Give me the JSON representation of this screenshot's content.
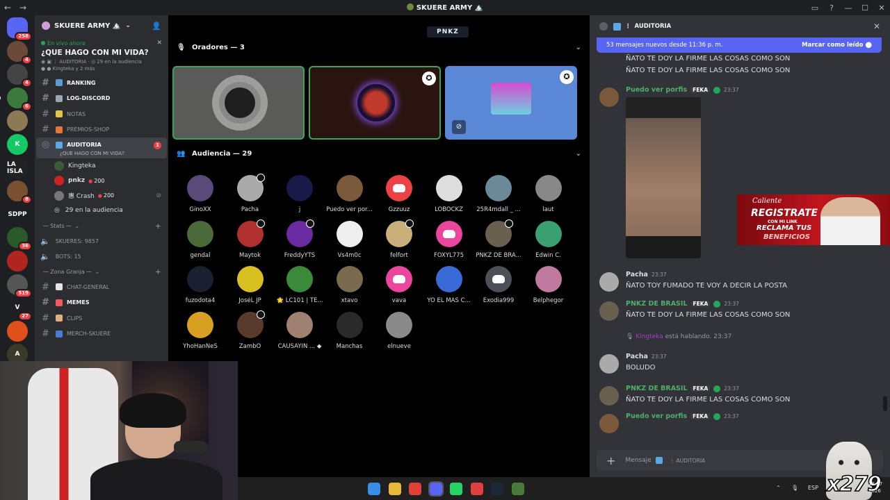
{
  "window": {
    "title": "SKUERE ARMY 🏔️",
    "controls": [
      "▭",
      "?",
      "—",
      "☐",
      "✕"
    ]
  },
  "servers": [
    {
      "label": "",
      "badge": "258",
      "color": "#5865f2",
      "home": true
    },
    {
      "label": "",
      "badge": "4",
      "color": "#6b4a3a"
    },
    {
      "label": "",
      "badge": "4",
      "color": "#444"
    },
    {
      "label": "",
      "badge": "6",
      "color": "#3a7a3a"
    },
    {
      "label": "",
      "badge": "",
      "color": "#8c7a55"
    },
    {
      "label": "K",
      "badge": "",
      "color": "#17c964"
    },
    {
      "label": "LA ISLA",
      "badge": "",
      "color": "#222"
    },
    {
      "label": "",
      "badge": "8",
      "color": "#7a5030"
    },
    {
      "label": "SDPP",
      "badge": "",
      "color": "#1e1f22"
    },
    {
      "label": "",
      "badge": "36",
      "color": "#2a5a2a"
    },
    {
      "label": "",
      "badge": "",
      "color": "#b0261e"
    },
    {
      "label": "",
      "badge": "519",
      "color": "#555"
    },
    {
      "label": "V",
      "badge": "27",
      "color": "#1e1f22"
    },
    {
      "label": "",
      "badge": "",
      "color": "#e0501c"
    },
    {
      "label": "A",
      "badge": "",
      "color": "#3a3a2a"
    }
  ],
  "sidebar": {
    "server_name": "SKUERE ARMY 🏔️",
    "event": {
      "live": "En vivo ahora",
      "title": "¿QUE HAGO CON MI VIDA?",
      "channel": "AUDITORIA",
      "audience": "29 en la audiencia",
      "users": "Kingteka y 2 más"
    },
    "channels": [
      {
        "name": "RANKING",
        "bold": true,
        "emoji": "#5a9bd8"
      },
      {
        "name": "LOG-DISCORD",
        "bold": true,
        "emoji": "#9aa6b2"
      },
      {
        "name": "NOTAS",
        "bold": false,
        "emoji": "#e6c34a"
      },
      {
        "name": "PREMIOS-SHOP",
        "bold": false,
        "emoji": "#e07a3a"
      }
    ],
    "active_channel": {
      "name": "AUDITORIA",
      "sub": "¿QUE HAGO CON MI VIDA?",
      "badge": "1"
    },
    "voice_users": [
      {
        "name": "Kingteka",
        "coins": "",
        "color": "#3a5a3a",
        "muted": false
      },
      {
        "name": "pnkz",
        "coins": "200",
        "color": "#c22",
        "muted": false
      },
      {
        "name": "惠 Crash",
        "coins": "200",
        "color": "#777",
        "muted": true
      }
    ],
    "audience_line": "29 en la audiencia",
    "stats_category": "Stats",
    "stats": [
      {
        "label": "SKUERES: 9857"
      },
      {
        "label": "BOTS: 15"
      }
    ],
    "granja_category": "Zona Granja",
    "granja_channels": [
      {
        "name": "CHAT-GENERAL",
        "bold": false,
        "emoji": "#e6e6e6"
      },
      {
        "name": "MEMES",
        "bold": true,
        "emoji": "#f05a5a"
      },
      {
        "name": "CLIPS",
        "bold": false,
        "emoji": "#e0b080"
      },
      {
        "name": "MERCH-SKUERE",
        "bold": false,
        "emoji": "#4a7ad8"
      }
    ]
  },
  "stage": {
    "logo": "PNKZ",
    "speakers_header": "Oradores — 3",
    "speakers": [
      {
        "bg": "#5a5a58",
        "border": "#3ba55c",
        "moderator": false,
        "muted": false
      },
      {
        "bg": "#2a1410",
        "border": "#3ba55c",
        "moderator": true,
        "muted": false
      },
      {
        "bg": "#5b88d6",
        "border": "",
        "moderator": true,
        "muted": true
      }
    ],
    "audience_header": "Audiencia — 29",
    "audience": [
      {
        "name": "GinoXX",
        "color": "#5a4a7a",
        "mod": false
      },
      {
        "name": "Pacha",
        "color": "#aaa",
        "mod": true
      },
      {
        "name": "j",
        "color": "#1a1a4a",
        "mod": false
      },
      {
        "name": "Puedo ver por...",
        "color": "#7a5a3a",
        "mod": false
      },
      {
        "name": "Gzzuuz",
        "discord": "red",
        "mod": false
      },
      {
        "name": "LOBOCKZ",
        "color": "#ddd",
        "mod": false
      },
      {
        "name": "25R4mdall _ ...",
        "color": "#6a8a9a",
        "mod": false
      },
      {
        "name": "laut",
        "color": "#888",
        "mod": false
      },
      {
        "name": "gendal",
        "color": "#4a6a3a",
        "mod": false
      },
      {
        "name": "Maytok",
        "color": "#b03030",
        "mod": true
      },
      {
        "name": "FreddyYTS",
        "color": "#6a2aa0",
        "mod": true
      },
      {
        "name": "Vs4m0c",
        "color": "#eee",
        "mod": false
      },
      {
        "name": "felfort",
        "color": "#c9b07a",
        "mod": true
      },
      {
        "name": "FOXYL775",
        "discord": "pink",
        "mod": false
      },
      {
        "name": "PNKZ DE BRA...",
        "color": "#6a6050",
        "mod": true
      },
      {
        "name": "Edwin C.",
        "color": "#3aa070",
        "mod": false
      },
      {
        "name": "fuzodota4",
        "color": "#1a2030",
        "mod": false
      },
      {
        "name": "JoséL JP",
        "color": "#d8c020",
        "mod": false
      },
      {
        "name": "🌟 LC101 | TE...",
        "color": "#3a8a3a",
        "mod": false
      },
      {
        "name": "xtavo",
        "color": "#7a6a50",
        "mod": false
      },
      {
        "name": "vava",
        "discord": "pink",
        "mod": false
      },
      {
        "name": "YO EL MAS C...",
        "color": "#3a6ad8",
        "mod": false
      },
      {
        "name": "Exodia999",
        "discord": "gray",
        "mod": false
      },
      {
        "name": "Belphegor",
        "color": "#c07aa0",
        "mod": false
      },
      {
        "name": "YhoHanNeS",
        "color": "#d8a020",
        "mod": false
      },
      {
        "name": "ZambO",
        "color": "#5a3a2a",
        "mod": true
      },
      {
        "name": "CAUSAYIN ... ◆",
        "color": "#a08070",
        "mod": false
      },
      {
        "name": "Manchas",
        "color": "#2a2a2a",
        "mod": false
      },
      {
        "name": "elnueve",
        "color": "#8a8a8a",
        "mod": false
      }
    ]
  },
  "chat": {
    "channel": "AUDITORIA",
    "new_messages": "53 mensajes nuevos desde 11:36 p. m.",
    "mark_read": "Marcar como leído",
    "continuation": [
      "ÑATO TE DOY LA FIRME LAS COSAS COMO SON",
      "ÑATO TE DOY LA FIRME LAS COSAS COMO SON"
    ],
    "messages": [
      {
        "user": "Puedo ver porfis",
        "color": "#4fae6a",
        "tag": "FEKA",
        "check": true,
        "time": "23:37",
        "text": "",
        "avatar": "#7a5a3a"
      },
      {
        "user": "Pacha",
        "color": "#dbdee1",
        "tag": "",
        "check": false,
        "time": "23:37",
        "text": "ÑATO TOY FUMADO TE VOY A DECIR LA POSTA",
        "avatar": "#aaa"
      },
      {
        "user": "PNKZ DE BRASIL",
        "color": "#4fae6a",
        "tag": "FEKA",
        "check": true,
        "time": "23:37",
        "text": "ÑATO TE DOY LA FIRME LAS COSAS COMO SON",
        "avatar": "#6a6050"
      },
      {
        "user": "Pacha",
        "color": "#dbdee1",
        "tag": "",
        "check": false,
        "time": "23:37",
        "text": "BOLUDO",
        "avatar": "#aaa"
      },
      {
        "user": "PNKZ DE BRASIL",
        "color": "#4fae6a",
        "tag": "FEKA",
        "check": true,
        "time": "23:37",
        "text": "ÑATO TE DOY LA FIRME LAS COSAS COMO SON",
        "avatar": "#6a6050"
      },
      {
        "user": "Puedo ver porfis",
        "color": "#4fae6a",
        "tag": "FEKA",
        "check": true,
        "time": "23:37",
        "text": "",
        "avatar": "#7a5a3a"
      }
    ],
    "speaking": {
      "user": "Kingteka",
      "text": "está hablando.",
      "time": "23:37"
    },
    "composer_placeholder": "Mensaje",
    "composer_channel": "AUDITORIA"
  },
  "ad": {
    "brand": "Caliente",
    "line1": "REGISTRATE",
    "line2": "CON MI LINK",
    "line3": "RECLAMA TUS",
    "line4": "BENEFICIOS"
  },
  "overlay": {
    "combo": "x279"
  },
  "taskbar": {
    "icons": [
      "#3a8ee6",
      "#e8b83a",
      "#e0403a",
      "#5865f2",
      "#25d366",
      "#e04040",
      "#1b2838",
      "#4a7a3a"
    ],
    "lang": "ESP",
    "time": "23:37",
    "year": "2026"
  }
}
